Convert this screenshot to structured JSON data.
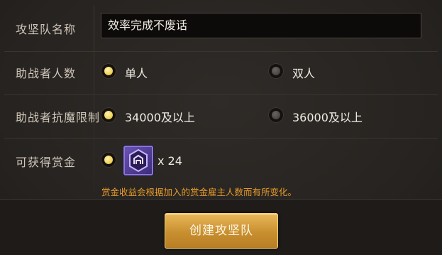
{
  "form": {
    "team_name_label": "攻坚队名称",
    "team_name_value": "效率完成不废话",
    "helper_count_label": "助战者人数",
    "helper_count_options": [
      "单人",
      "双人"
    ],
    "helper_count_selected": "单人",
    "resist_limit_label": "助战者抗魔限制",
    "resist_limit_options": [
      "34000及以上",
      "36000及以上"
    ],
    "resist_limit_selected": "34000及以上",
    "reward_label": "可获得赏金",
    "reward_count": "x 24",
    "reward_icon": "bounty-emblem-icon",
    "reward_notice": "赏金收益会根据加入的赏金雇主人数而有所变化。",
    "create_button_label": "创建攻坚队"
  },
  "colors": {
    "background": "#2a2724",
    "radio_selected": "#f0d35a",
    "notice": "#e79b2a",
    "button": "#d9a343"
  }
}
